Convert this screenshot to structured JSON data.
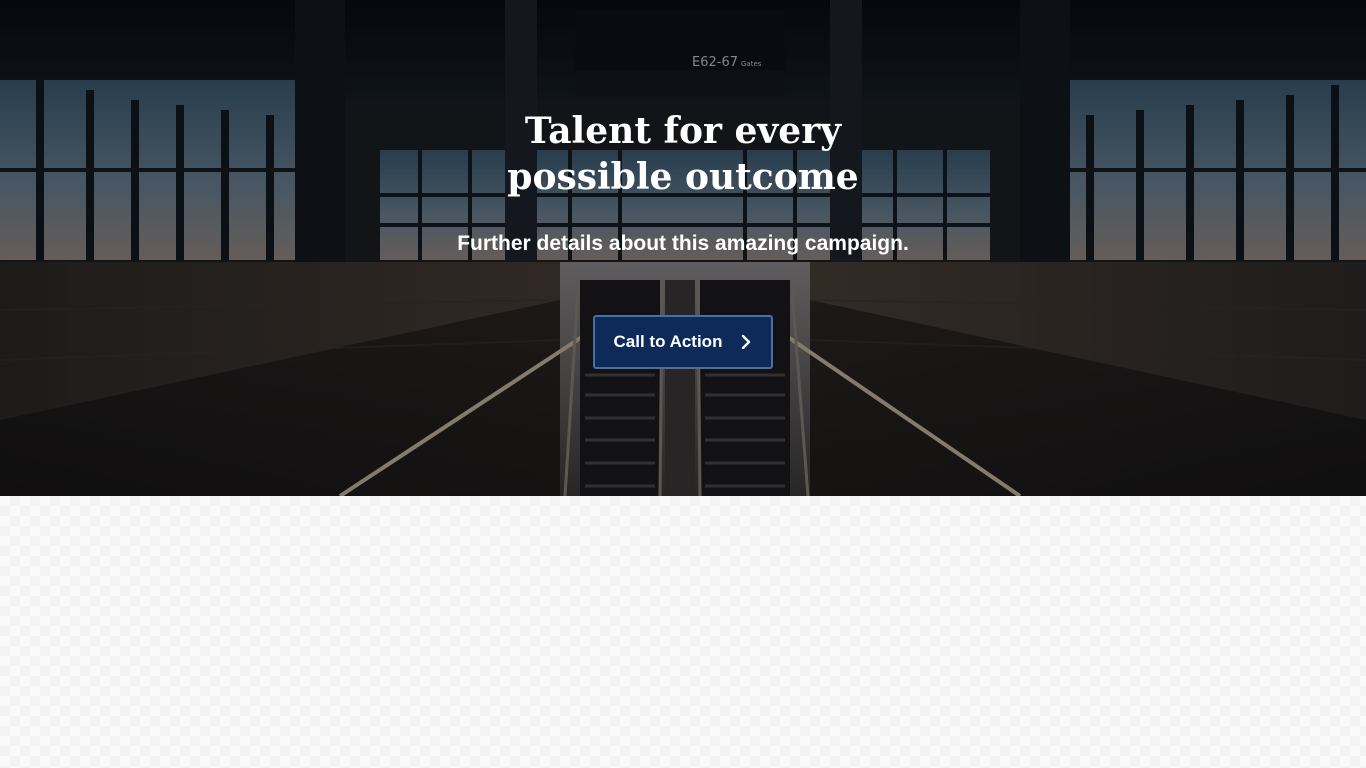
{
  "hero": {
    "title_line1": "Talent for every",
    "title_line2": "possible outcome",
    "subtitle": "Further details about this amazing campaign.",
    "cta_label": "Call to Action",
    "cta_icon": "chevron-right-icon",
    "sign_text": "E62-67",
    "sign_small": "Gates"
  },
  "colors": {
    "button_background": "#0d2a58",
    "button_border": "#4b6fa3",
    "text": "#ffffff",
    "lower_background": "#fafafa"
  }
}
